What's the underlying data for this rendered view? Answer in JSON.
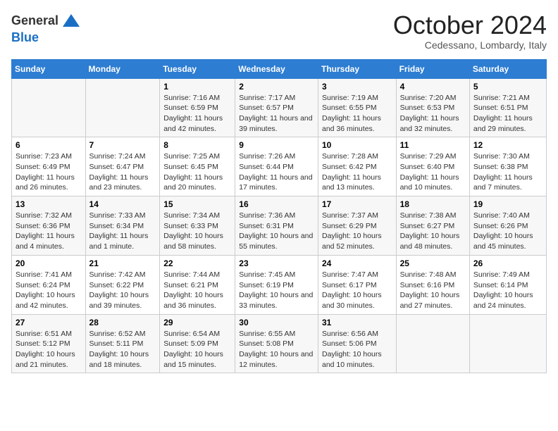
{
  "logo": {
    "general": "General",
    "blue": "Blue",
    "tagline": "GeneralBlue"
  },
  "header": {
    "month_title": "October 2024",
    "location": "Cedessano, Lombardy, Italy"
  },
  "columns": [
    "Sunday",
    "Monday",
    "Tuesday",
    "Wednesday",
    "Thursday",
    "Friday",
    "Saturday"
  ],
  "weeks": [
    [
      {
        "day": "",
        "info": ""
      },
      {
        "day": "",
        "info": ""
      },
      {
        "day": "1",
        "info": "Sunrise: 7:16 AM\nSunset: 6:59 PM\nDaylight: 11 hours and 42 minutes."
      },
      {
        "day": "2",
        "info": "Sunrise: 7:17 AM\nSunset: 6:57 PM\nDaylight: 11 hours and 39 minutes."
      },
      {
        "day": "3",
        "info": "Sunrise: 7:19 AM\nSunset: 6:55 PM\nDaylight: 11 hours and 36 minutes."
      },
      {
        "day": "4",
        "info": "Sunrise: 7:20 AM\nSunset: 6:53 PM\nDaylight: 11 hours and 32 minutes."
      },
      {
        "day": "5",
        "info": "Sunrise: 7:21 AM\nSunset: 6:51 PM\nDaylight: 11 hours and 29 minutes."
      }
    ],
    [
      {
        "day": "6",
        "info": "Sunrise: 7:23 AM\nSunset: 6:49 PM\nDaylight: 11 hours and 26 minutes."
      },
      {
        "day": "7",
        "info": "Sunrise: 7:24 AM\nSunset: 6:47 PM\nDaylight: 11 hours and 23 minutes."
      },
      {
        "day": "8",
        "info": "Sunrise: 7:25 AM\nSunset: 6:45 PM\nDaylight: 11 hours and 20 minutes."
      },
      {
        "day": "9",
        "info": "Sunrise: 7:26 AM\nSunset: 6:44 PM\nDaylight: 11 hours and 17 minutes."
      },
      {
        "day": "10",
        "info": "Sunrise: 7:28 AM\nSunset: 6:42 PM\nDaylight: 11 hours and 13 minutes."
      },
      {
        "day": "11",
        "info": "Sunrise: 7:29 AM\nSunset: 6:40 PM\nDaylight: 11 hours and 10 minutes."
      },
      {
        "day": "12",
        "info": "Sunrise: 7:30 AM\nSunset: 6:38 PM\nDaylight: 11 hours and 7 minutes."
      }
    ],
    [
      {
        "day": "13",
        "info": "Sunrise: 7:32 AM\nSunset: 6:36 PM\nDaylight: 11 hours and 4 minutes."
      },
      {
        "day": "14",
        "info": "Sunrise: 7:33 AM\nSunset: 6:34 PM\nDaylight: 11 hours and 1 minute."
      },
      {
        "day": "15",
        "info": "Sunrise: 7:34 AM\nSunset: 6:33 PM\nDaylight: 10 hours and 58 minutes."
      },
      {
        "day": "16",
        "info": "Sunrise: 7:36 AM\nSunset: 6:31 PM\nDaylight: 10 hours and 55 minutes."
      },
      {
        "day": "17",
        "info": "Sunrise: 7:37 AM\nSunset: 6:29 PM\nDaylight: 10 hours and 52 minutes."
      },
      {
        "day": "18",
        "info": "Sunrise: 7:38 AM\nSunset: 6:27 PM\nDaylight: 10 hours and 48 minutes."
      },
      {
        "day": "19",
        "info": "Sunrise: 7:40 AM\nSunset: 6:26 PM\nDaylight: 10 hours and 45 minutes."
      }
    ],
    [
      {
        "day": "20",
        "info": "Sunrise: 7:41 AM\nSunset: 6:24 PM\nDaylight: 10 hours and 42 minutes."
      },
      {
        "day": "21",
        "info": "Sunrise: 7:42 AM\nSunset: 6:22 PM\nDaylight: 10 hours and 39 minutes."
      },
      {
        "day": "22",
        "info": "Sunrise: 7:44 AM\nSunset: 6:21 PM\nDaylight: 10 hours and 36 minutes."
      },
      {
        "day": "23",
        "info": "Sunrise: 7:45 AM\nSunset: 6:19 PM\nDaylight: 10 hours and 33 minutes."
      },
      {
        "day": "24",
        "info": "Sunrise: 7:47 AM\nSunset: 6:17 PM\nDaylight: 10 hours and 30 minutes."
      },
      {
        "day": "25",
        "info": "Sunrise: 7:48 AM\nSunset: 6:16 PM\nDaylight: 10 hours and 27 minutes."
      },
      {
        "day": "26",
        "info": "Sunrise: 7:49 AM\nSunset: 6:14 PM\nDaylight: 10 hours and 24 minutes."
      }
    ],
    [
      {
        "day": "27",
        "info": "Sunrise: 6:51 AM\nSunset: 5:12 PM\nDaylight: 10 hours and 21 minutes."
      },
      {
        "day": "28",
        "info": "Sunrise: 6:52 AM\nSunset: 5:11 PM\nDaylight: 10 hours and 18 minutes."
      },
      {
        "day": "29",
        "info": "Sunrise: 6:54 AM\nSunset: 5:09 PM\nDaylight: 10 hours and 15 minutes."
      },
      {
        "day": "30",
        "info": "Sunrise: 6:55 AM\nSunset: 5:08 PM\nDaylight: 10 hours and 12 minutes."
      },
      {
        "day": "31",
        "info": "Sunrise: 6:56 AM\nSunset: 5:06 PM\nDaylight: 10 hours and 10 minutes."
      },
      {
        "day": "",
        "info": ""
      },
      {
        "day": "",
        "info": ""
      }
    ]
  ]
}
